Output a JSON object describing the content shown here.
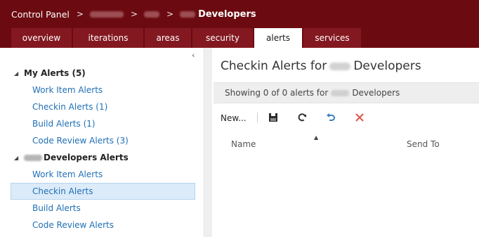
{
  "breadcrumb": {
    "root": "Control Panel",
    "separator": ">",
    "current": "Developers"
  },
  "tabs": [
    {
      "label": "overview",
      "active": false
    },
    {
      "label": "iterations",
      "active": false
    },
    {
      "label": "areas",
      "active": false
    },
    {
      "label": "security",
      "active": false
    },
    {
      "label": "alerts",
      "active": true
    },
    {
      "label": "services",
      "active": false
    }
  ],
  "left_panel": {
    "collapse_glyph": "‹",
    "groups": [
      {
        "title": "My Alerts (5)",
        "items": [
          "Work Item Alerts",
          "Checkin Alerts (1)",
          "Build Alerts (1)",
          "Code Review Alerts (3)"
        ]
      },
      {
        "title": "Developers Alerts",
        "items": [
          "Work Item Alerts",
          "Checkin Alerts",
          "Build Alerts",
          "Code Review Alerts"
        ]
      }
    ],
    "selected_item": "Checkin Alerts"
  },
  "main": {
    "title_prefix": "Checkin Alerts for",
    "title_suffix": "Developers",
    "info_prefix": "Showing 0 of 0 alerts for",
    "info_suffix": "Developers",
    "toolbar": {
      "new_label": "New...",
      "icons": [
        "save-icon",
        "refresh-icon",
        "undo-icon",
        "delete-icon"
      ]
    },
    "columns": [
      "Name",
      "Send To"
    ],
    "sort_indicator": "▲"
  },
  "colors": {
    "header": "#6b0a10",
    "tab": "#831820",
    "link": "#1f6fb5",
    "selection": "#dcebf9",
    "delete": "#e05a4f",
    "undo": "#3a7fc1"
  }
}
